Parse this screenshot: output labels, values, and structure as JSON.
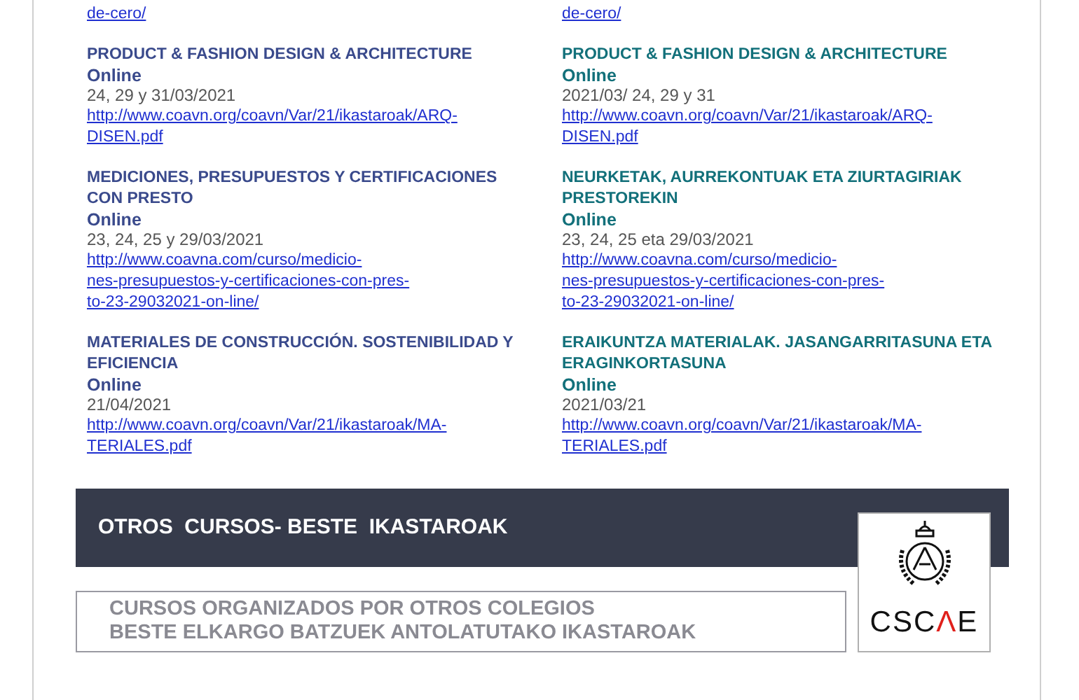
{
  "columns": [
    {
      "color": "#3a4a8c",
      "top_link": "de-cero/",
      "courses": [
        {
          "title": "PRODUCT & FASHION DESIGN & ARCHITECTURE",
          "mode": "Online",
          "date": "24, 29 y 31/03/2021",
          "link": [
            "http://www.coavn.org/coavn/Var/21/ikastaroak/ARQ-",
            "DISEN.pdf"
          ]
        },
        {
          "title": "MEDICIONES, PRESUPUESTOS Y CERTIFICACIONES CON PRESTO",
          "mode": "Online",
          "date": "23, 24, 25 y 29/03/2021",
          "link": [
            "http://www.coavna.com/curso/medicio-",
            "nes-presupuestos-y-certificaciones-con-pres-",
            "to-23-29032021-on-line/"
          ]
        },
        {
          "title": "MATERIALES DE CONSTRUCCIÓN. SOSTENIBILIDAD Y EFICIENCIA",
          "mode": "Online",
          "date": "21/04/2021",
          "link": [
            "http://www.coavn.org/coavn/Var/21/ikastaroak/MA-",
            "TERIALES.pdf"
          ]
        }
      ]
    },
    {
      "color": "#12707a",
      "top_link": "de-cero/",
      "courses": [
        {
          "title": "PRODUCT & FASHION DESIGN & ARCHITECTURE",
          "mode": "Online",
          "date": "2021/03/ 24, 29 y 31",
          "link": [
            "http://www.coavn.org/coavn/Var/21/ikastaroak/ARQ-",
            "DISEN.pdf"
          ]
        },
        {
          "title": "NEURKETAK, AURREKONTUAK ETA ZIURTAGIRIAK PRESTOREKIN",
          "mode": "Online",
          "date": "23, 24, 25 eta 29/03/2021",
          "link": [
            "http://www.coavna.com/curso/medicio-",
            "nes-presupuestos-y-certificaciones-con-pres-",
            "to-23-29032021-on-line/"
          ]
        },
        {
          "title": "ERAIKUNTZA MATERIALAK. JASANGARRITASUNA ETA ERAGINKORTASUNA",
          "mode": "Online",
          "date": "2021/03/21",
          "link": [
            "http://www.coavn.org/coavn/Var/21/ikastaroak/MA-",
            "TERIALES.pdf"
          ]
        }
      ]
    }
  ],
  "banner": {
    "title": "OTROS  CURSOS- BESTE  IKASTAROAK"
  },
  "subtitle": [
    "CURSOS ORGANIZADOS POR OTROS COLEGIOS",
    "BESTE ELKARGO BATZUEK ANTOLATUTAKO IKASTAROAK"
  ],
  "logo": {
    "parts": [
      {
        "text": "CSC",
        "color": "#111111"
      },
      {
        "text": "Λ",
        "color": "#e0201b"
      },
      {
        "text": "E",
        "color": "#111111"
      }
    ]
  }
}
